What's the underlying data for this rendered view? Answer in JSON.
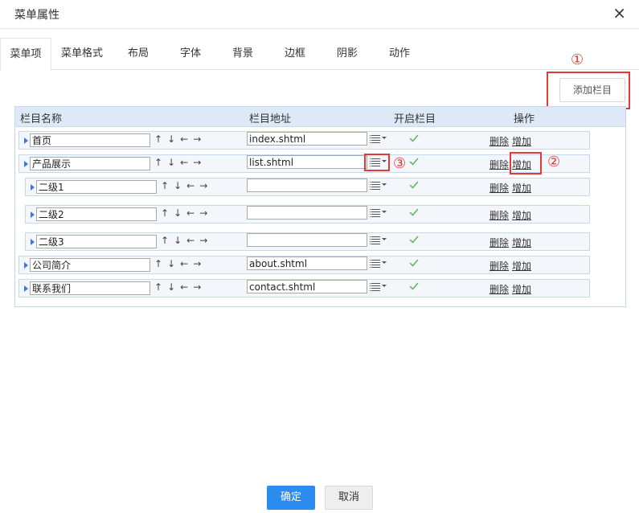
{
  "dialog": {
    "title": "菜单属性",
    "close_icon": "×"
  },
  "tabs": [
    {
      "label": "菜单项",
      "active": true
    },
    {
      "label": "菜单格式"
    },
    {
      "label": "布局"
    },
    {
      "label": "字体"
    },
    {
      "label": "背景"
    },
    {
      "label": "边框"
    },
    {
      "label": "阴影"
    },
    {
      "label": "动作"
    }
  ],
  "toolbar": {
    "add_column_label": "添加栏目"
  },
  "callouts": {
    "one": "①",
    "two": "②",
    "three": "③"
  },
  "table": {
    "headers": {
      "name": "栏目名称",
      "url": "栏目地址",
      "enabled": "开启栏目",
      "actions": "操作"
    },
    "arrow_glyphs": [
      "↑",
      "↓",
      "←",
      "→"
    ],
    "delete_label": "删除",
    "add_label": "增加",
    "rows": [
      {
        "name": "首页",
        "url": "index.shtml",
        "level": 1,
        "enabled": true
      },
      {
        "name": "产品展示",
        "url": "list.shtml",
        "level": 1,
        "enabled": true
      },
      {
        "name": "二级1",
        "url": "",
        "level": 2,
        "enabled": true
      },
      {
        "name": "二级2",
        "url": "",
        "level": 2,
        "enabled": true
      },
      {
        "name": "二级3",
        "url": "",
        "level": 2,
        "enabled": true
      },
      {
        "name": "公司简介",
        "url": "about.shtml",
        "level": 1,
        "enabled": true
      },
      {
        "name": "联系我们",
        "url": "contact.shtml",
        "level": 1,
        "enabled": true
      }
    ]
  },
  "footer": {
    "ok_label": "确定",
    "cancel_label": "取消"
  },
  "colors": {
    "primary": "#2d8cf0",
    "callout": "#e53935",
    "check": "#5cb85c",
    "header_bg": "#dde9f7"
  }
}
